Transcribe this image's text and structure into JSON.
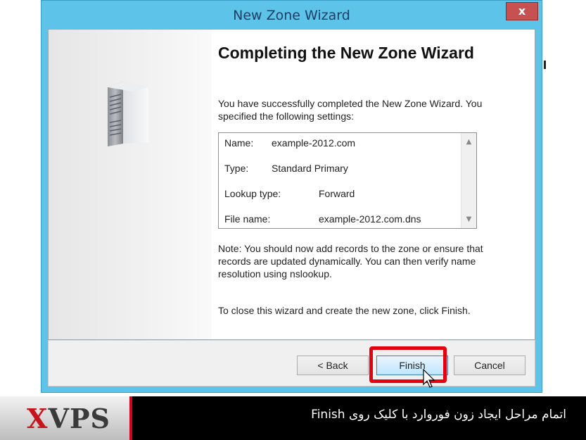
{
  "window": {
    "title": "New Zone Wizard",
    "close_label": "x"
  },
  "wizard": {
    "heading": "Completing the New Zone Wizard",
    "intro": "You have successfully completed the New Zone Wizard. You specified the following settings:",
    "settings": [
      {
        "label": "Name:",
        "value": "example-2012.com"
      },
      {
        "label": "Type:",
        "value": "Standard Primary"
      },
      {
        "label": "Lookup type:",
        "value": "Forward"
      },
      {
        "label": "File name:",
        "value": "example-2012.com.dns"
      }
    ],
    "note": "Note: You should now add records to the zone or ensure that records are updated dynamically. You can then verify name resolution using nslookup.",
    "close_instruction": "To close this wizard and create the new zone, click Finish."
  },
  "buttons": {
    "back": "< Back",
    "finish": "Finish",
    "cancel": "Cancel"
  },
  "banner": {
    "logo_x": "X",
    "logo_rest": "VPS",
    "caption": "اتمام مراحل ایجاد زون فوروارد با کلیک روی Finish"
  },
  "colors": {
    "window_frame": "#5dc3e8",
    "highlight": "#e3000f",
    "close_button": "#c75050"
  },
  "icons": {
    "wizard": "server-icon",
    "cursor": "mouse-pointer-icon"
  }
}
